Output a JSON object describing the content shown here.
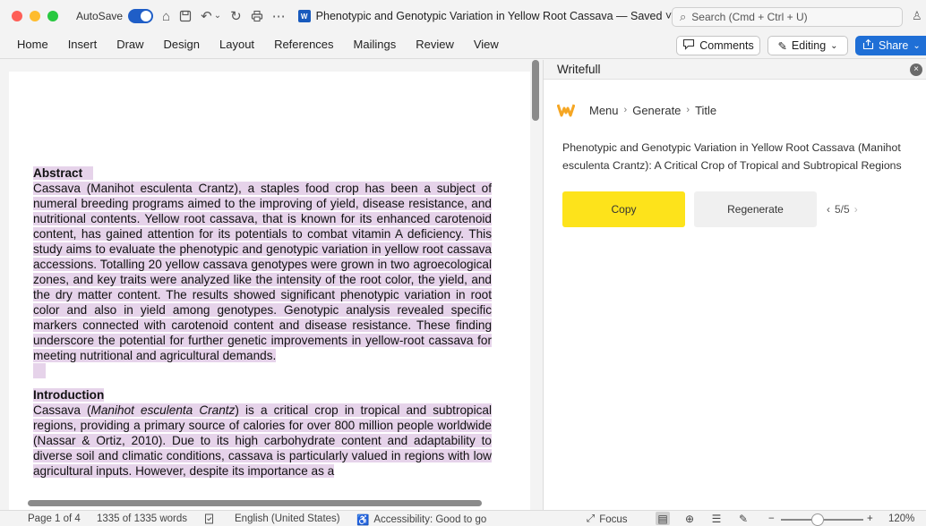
{
  "window": {
    "autosave_label": "AutoSave",
    "doc_title": "Phenotypic and Genotypic Variation in Yellow Root Cassava — Saved ˅",
    "search_placeholder": "Search (Cmd + Ctrl + U)",
    "doc_icon_letter": "W"
  },
  "ribbon": {
    "tabs": [
      "Home",
      "Insert",
      "Draw",
      "Design",
      "Layout",
      "References",
      "Mailings",
      "Review",
      "View"
    ],
    "comments_label": "Comments",
    "editing_label": "Editing",
    "share_label": "Share"
  },
  "document": {
    "abstract_heading": "Abstract",
    "abstract_text": "Cassava (Manihot esculenta Crantz), a staples food crop has been a subject of numeral breeding programs aimed to the improving of yield, disease resistance, and nutritional contents. Yellow root cassava, that is known for its enhanced carotenoid content, has gained attention for its potentials to combat vitamin A deficiency. This study aims to evaluate the phenotypic and genotypic variation in yellow root cassava accessions. Totalling 20 yellow cassava genotypes were grown in two agroecological zones, and key traits were analyzed like the intensity of the root color, the yield, and the dry matter content. The results showed significant phenotypic variation in root color and also in yield among genotypes. Genotypic analysis revealed specific markers connected with carotenoid content and disease resistance. These finding underscore the potential for further genetic improvements in yellow-root cassava for meeting nutritional and agricultural demands.",
    "intro_heading": "Introduction",
    "intro_lead": "Cassava (",
    "intro_italic": "Manihot esculenta Crantz",
    "intro_text": ") is a critical crop in tropical and subtropical regions, providing a primary source of calories for over 800 million people worldwide (Nassar & Ortiz, 2010). Due to its high carbohydrate content and adaptability to diverse soil and climatic conditions, cassava is particularly valued in regions with low agricultural inputs. However, despite its importance as a"
  },
  "writefull": {
    "panel_title": "Writefull",
    "close_icon": "×",
    "breadcrumb": [
      "Menu",
      "Generate",
      "Title"
    ],
    "result_text": "Phenotypic and Genotypic Variation in Yellow Root Cassava (Manihot esculenta Crantz): A Critical Crop of Tropical and Subtropical Regions",
    "copy_label": "Copy",
    "regenerate_label": "Regenerate",
    "pager_text": "5/5"
  },
  "statusbar": {
    "page": "Page 1 of 4",
    "words": "1335 of 1335 words",
    "language": "English (United States)",
    "accessibility": "Accessibility: Good to go",
    "focus": "Focus",
    "zoom_level": "120%",
    "zoom_value": 0.45
  },
  "colors": {
    "highlight": "#e6d3ea",
    "share_blue": "#1f6fd6",
    "copy_yellow": "#fde31b"
  }
}
